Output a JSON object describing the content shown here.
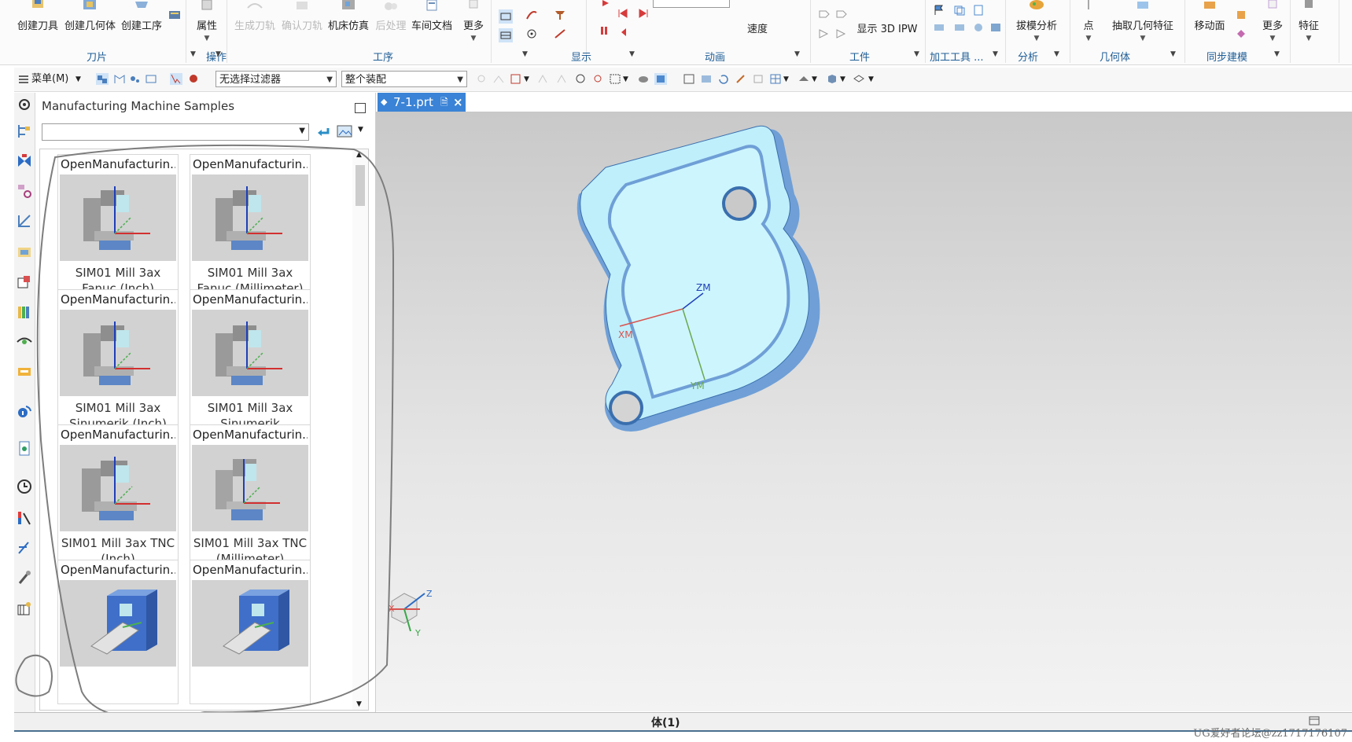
{
  "ribbon": {
    "buttons": [
      {
        "label": "创建刀具",
        "state": "enabled"
      },
      {
        "label": "创建几何体",
        "state": "enabled"
      },
      {
        "label": "创建工序",
        "state": "enabled"
      },
      {
        "label": "属性",
        "state": "enabled"
      },
      {
        "label": "生成刀轨",
        "state": "disabled"
      },
      {
        "label": "确认刀轨",
        "state": "disabled"
      },
      {
        "label": "机床仿真",
        "state": "enabled"
      },
      {
        "label": "后处理",
        "state": "disabled"
      },
      {
        "label": "车间文档",
        "state": "enabled"
      },
      {
        "label": "更多",
        "state": "enabled"
      },
      {
        "label": "速度",
        "state": "enabled"
      },
      {
        "label": "显示 3D IPW",
        "state": "enabled"
      },
      {
        "label": "拔模分析",
        "state": "enabled"
      },
      {
        "label": "点",
        "state": "enabled"
      },
      {
        "label": "抽取几何特征",
        "state": "enabled"
      },
      {
        "label": "移动面",
        "state": "enabled"
      },
      {
        "label": "更多",
        "state": "enabled"
      },
      {
        "label": "特征",
        "state": "enabled"
      }
    ],
    "groups": [
      "刀片",
      "操作",
      "工序",
      "显示",
      "动画",
      "工件",
      "加工工具 ...",
      "分析",
      "几何体",
      "同步建模"
    ]
  },
  "toolbar": {
    "menu_label": "菜单(M)",
    "filter_select": "无选择过滤器",
    "assembly_select": "整个装配"
  },
  "nav_panel": {
    "title": "Manufacturing Machine Samples",
    "filter_value": "",
    "cards": [
      {
        "header": "OpenManufacturin...",
        "name_line1": "SIM01 Mill 3ax",
        "name_line2": "Fanuc (Inch)"
      },
      {
        "header": "OpenManufacturin...",
        "name_line1": "SIM01 Mill 3ax",
        "name_line2": "Fanuc (Millimeter)"
      },
      {
        "header": "OpenManufacturin...",
        "name_line1": "SIM01 Mill 3ax",
        "name_line2": "Sinumerik (Inch)"
      },
      {
        "header": "OpenManufacturin...",
        "name_line1": "SIM01 Mill 3ax",
        "name_line2": "Sinumerik"
      },
      {
        "header": "OpenManufacturin...",
        "name_line1": "SIM01 Mill 3ax TNC",
        "name_line2": "(Inch)"
      },
      {
        "header": "OpenManufacturin...",
        "name_line1": "SIM01 Mill 3ax TNC",
        "name_line2": "(Millimeter)"
      },
      {
        "header": "OpenManufacturin...",
        "name_line1": "",
        "name_line2": ""
      },
      {
        "header": "OpenManufacturin...",
        "name_line1": "",
        "name_line2": ""
      }
    ]
  },
  "document_tab": {
    "label": "7-1.prt"
  },
  "viewport": {
    "axis_labels": {
      "zm": "ZM",
      "xm": "XM",
      "ym": "YM"
    },
    "triad_labels": {
      "x": "X",
      "y": "Y",
      "z": "Z"
    }
  },
  "status": {
    "text": "体(1)"
  },
  "watermark": "UG爱好者论坛@zz1717176107",
  "colors": {
    "accent": "#3a83d6",
    "part_face": "#bfeffb",
    "part_side": "#6f9fd6",
    "sketch_stroke": "#7d7d7d"
  }
}
